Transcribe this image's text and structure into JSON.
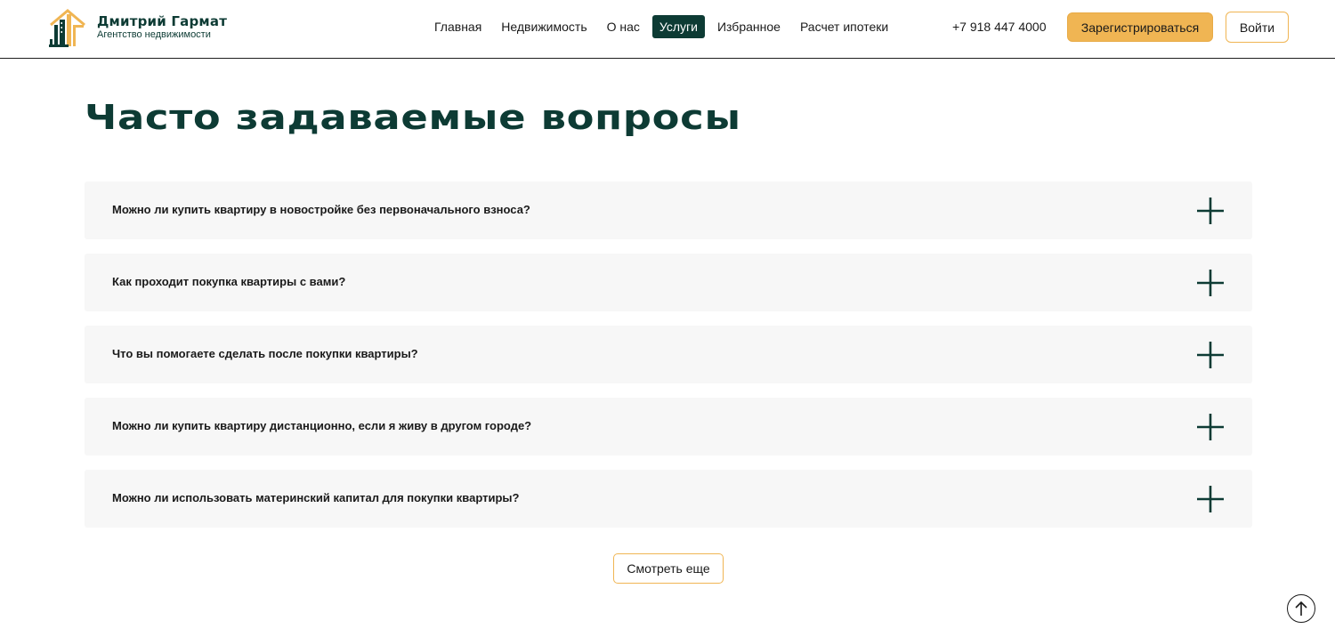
{
  "header": {
    "logo": {
      "name": "Дмитрий Гармат",
      "subtitle": "Агентство недвижимости"
    },
    "nav": [
      {
        "label": "Главная",
        "active": false
      },
      {
        "label": "Недвижимость",
        "active": false
      },
      {
        "label": "О нас",
        "active": false
      },
      {
        "label": "Услуги",
        "active": true
      },
      {
        "label": "Избранное",
        "active": false
      },
      {
        "label": "Расчет ипотеки",
        "active": false
      }
    ],
    "phone": "+7 918 447 4000",
    "register_label": "Зарегистрироваться",
    "login_label": "Войти"
  },
  "faq": {
    "title": "Часто задаваемые вопросы",
    "items": [
      {
        "question": "Можно ли купить квартиру в новостройке без первоначального взноса?"
      },
      {
        "question": "Как проходит покупка квартиры с вами?"
      },
      {
        "question": "Что вы помогаете сделать после покупки квартиры?"
      },
      {
        "question": "Можно ли купить квартиру дистанционно, если я живу в другом городе?"
      },
      {
        "question": "Можно ли использовать материнский капитал для покупки квартиры?"
      }
    ],
    "more_label": "Смотреть еще"
  },
  "icons": {
    "expand": "plus-icon",
    "scroll_top": "arrow-up-icon"
  },
  "colors": {
    "brand_dark": "#0d3b34",
    "accent": "#f0b553",
    "card_bg": "#f7f7f7"
  }
}
